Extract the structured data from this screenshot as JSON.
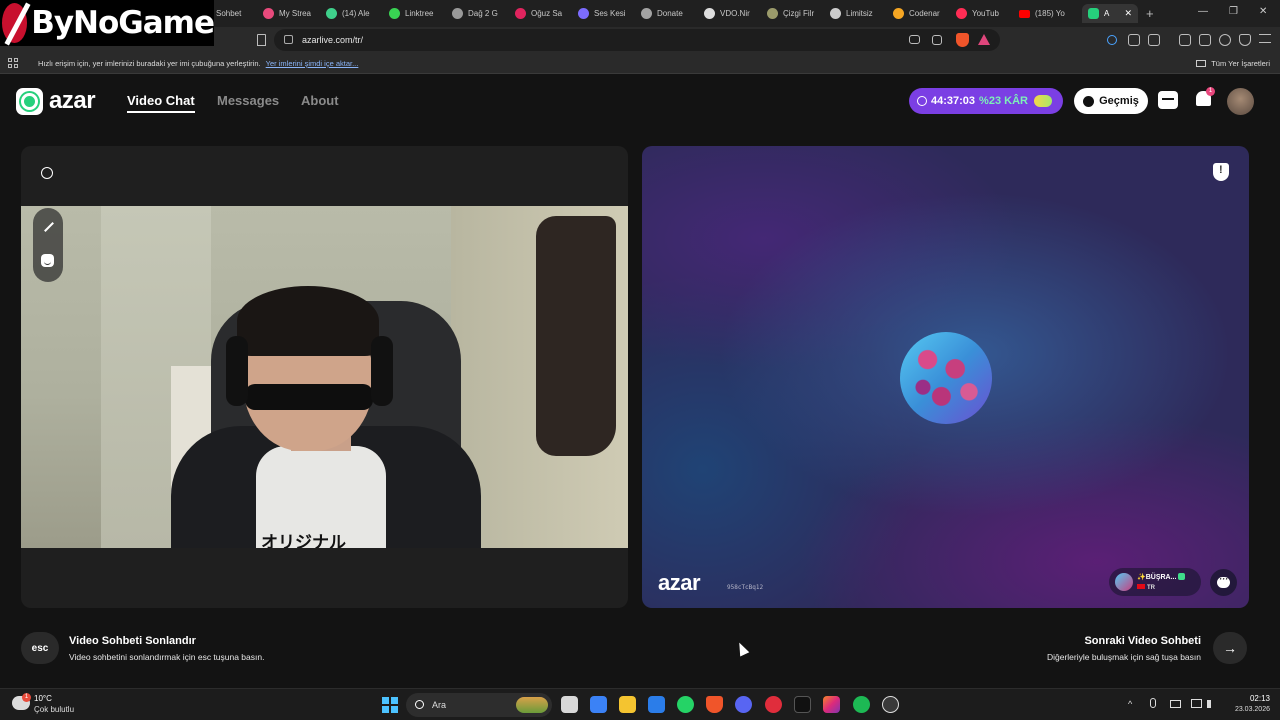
{
  "overlay": {
    "channel_logo_text": "ByNoGame"
  },
  "browser": {
    "tabs": [
      {
        "label": "Sohbet",
        "color": "#888888"
      },
      {
        "label": "My Strea",
        "color": "#e84a7c"
      },
      {
        "label": "(14) Ale",
        "color": "#3fd08b"
      },
      {
        "label": "Linktree",
        "color": "#39d353"
      },
      {
        "label": "Dağ 2 G",
        "color": "#999999"
      },
      {
        "label": "Oğuz Sa",
        "color": "#e0245e"
      },
      {
        "label": "Ses Kesi",
        "color": "#7c6cff"
      },
      {
        "label": "Donate",
        "color": "#a3a3a3"
      },
      {
        "label": "VDO.Nir",
        "color": "#dddddd"
      },
      {
        "label": "Çizgi Filr",
        "color": "#9b9b6b"
      },
      {
        "label": "Limitsiz",
        "color": "#cccccc"
      },
      {
        "label": "Codenar",
        "color": "#f5a623"
      },
      {
        "label": "YouTub",
        "color": "#ff2d55"
      },
      {
        "label": "(185) Yo",
        "color": "#ff0000"
      },
      {
        "label": "A",
        "color": "#26d07c"
      }
    ],
    "new_tab_symbol": "+",
    "window_controls": {
      "minimize": "—",
      "maximize": "❐",
      "close": "✕"
    },
    "url": "azarlive.com/tr/",
    "bookmarks_bar": {
      "text": "Hızlı erişim için, yer imlerinizi buradaki yer imi çubuğuna yerleştirin.",
      "link": "Yer imlerini şimdi içe aktar...",
      "all_bookmarks": "Tüm Yer İşaretleri"
    }
  },
  "azar": {
    "brand": "azar",
    "nav": {
      "video_chat": "Video Chat",
      "messages": "Messages",
      "about": "About"
    },
    "timer": {
      "time": "44:37:03",
      "promo": "%23 KÂR"
    },
    "history_button": "Geçmiş",
    "notification_count": "1",
    "left_panel": {
      "shirt_text": "オリジナル"
    },
    "right_panel": {
      "watermark": "azar",
      "session_id": "958cTcBq12",
      "peer_name": "✨BÜŞRA...",
      "peer_country": "TR"
    },
    "hints": {
      "end_key": "esc",
      "end_title": "Video Sohbeti Sonlandır",
      "end_sub": "Video sohbetini sonlandırmak için esc tuşuna basın.",
      "next_title": "Sonraki Video Sohbeti",
      "next_sub": "Diğerleriyle buluşmak için sağ tuşa basın",
      "next_arrow": "→"
    }
  },
  "taskbar": {
    "weather_temp": "10°C",
    "weather_condition": "Çok bulutlu",
    "weather_badge": "1",
    "search_placeholder": "Ara",
    "time": "02:13",
    "date": "23.03.2026"
  }
}
